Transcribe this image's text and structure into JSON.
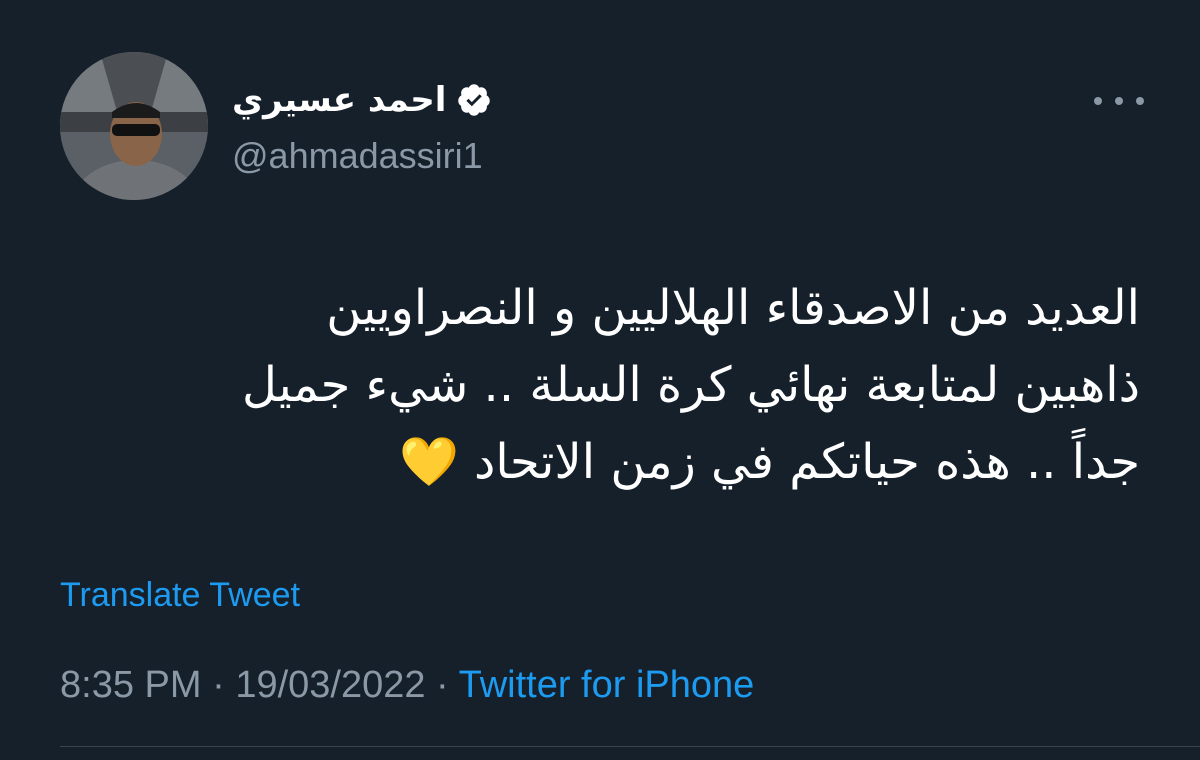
{
  "user": {
    "display_name": "احمد عسيري",
    "handle": "@ahmadassiri1",
    "verified": true,
    "avatar_icon": "user-avatar"
  },
  "tweet": {
    "text": "العديد من الاصدقاء الهلاليين و النصراويين\nذاهبين لمتابعة نهائي كرة السلة .. شيء جميل\nجداً .. هذه حياتكم في زمن الاتحاد 💛"
  },
  "translate_label": "Translate Tweet",
  "meta": {
    "time": "8:35 PM",
    "separator": " · ",
    "date": "19/03/2022",
    "source": "Twitter for iPhone"
  },
  "colors": {
    "background": "#15202b",
    "accent": "#1d9bf0",
    "secondary_text": "#8b98a5"
  },
  "icons": {
    "more": "more-options-icon",
    "verified": "verified-badge-icon"
  }
}
